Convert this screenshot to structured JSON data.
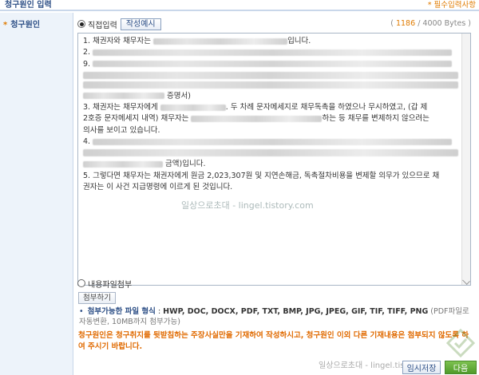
{
  "header": {
    "title": "청구원인 입력",
    "required_note": "* 필수입력사항"
  },
  "sidebar": {
    "items": [
      {
        "star": "*",
        "label": "청구원인"
      }
    ]
  },
  "editor": {
    "mode_direct_label": "직접입력",
    "example_button": "작성예시",
    "counter_open": "(",
    "counter_used": "1186",
    "counter_rest": "/ 4000 Bytes )",
    "lines": {
      "l1a": "1. 채권자와 채무자는",
      "l1b": "입니다.",
      "l2a": "2.",
      "l3a": "9.",
      "l6b": "증명서)",
      "l7a": "3. 채권자는 채무자에게",
      "l7b": ". 두 차례 문자메세지로 채무독촉을 하였으나 무시하였고, (갑 제",
      "l8a": "2호증 문자메세지 내역) 채무자는",
      "l8b": "하는 등 채무를 변제하지 않으려는",
      "l9": "의사를 보이고 있습니다.",
      "l10a": "4.",
      "l12b": "금액)입니다.",
      "l13": "5. 그렇다면 채무자는 채권자에게 원금 2,023,307원 및 지연손해금, 독촉절차비용을 변제할 의무가 있으므로 채",
      "l14": "권자는 이 사건 지급명령에 이르게 된 것입니다."
    },
    "watermark": "일상으로초대  -  lingel.tistory.com"
  },
  "attachment": {
    "mode_file_label": "내용파일첨부",
    "attach_button": "첨부하기",
    "formats_bullet": "•",
    "formats_label": "첨부가능한 파일 형식",
    "formats_colon": " : ",
    "formats_types": "HWP, DOC, DOCX, PDF, TXT, BMP, JPG, JPEG, GIF, TIF, TIFF, PNG",
    "formats_note": " (PDF파일로 자동변환, 10MB까지 첨부가능)"
  },
  "warning": "청구원인은 청구취지를 뒷받침하는 주장사실만을 기재하여 작성하시고, 청구원인 이외 다른 기재내용은 첨부되지 않도록 하여 주시기 바랍니다.",
  "footer": {
    "watermark": "일상으로초대 - lingel.tistory.com",
    "save_button": "임시저장",
    "next_button": "다음"
  },
  "colors": {
    "accent_blue": "#2d4f86",
    "accent_orange": "#e07b00",
    "next_green": "#5aa335"
  }
}
